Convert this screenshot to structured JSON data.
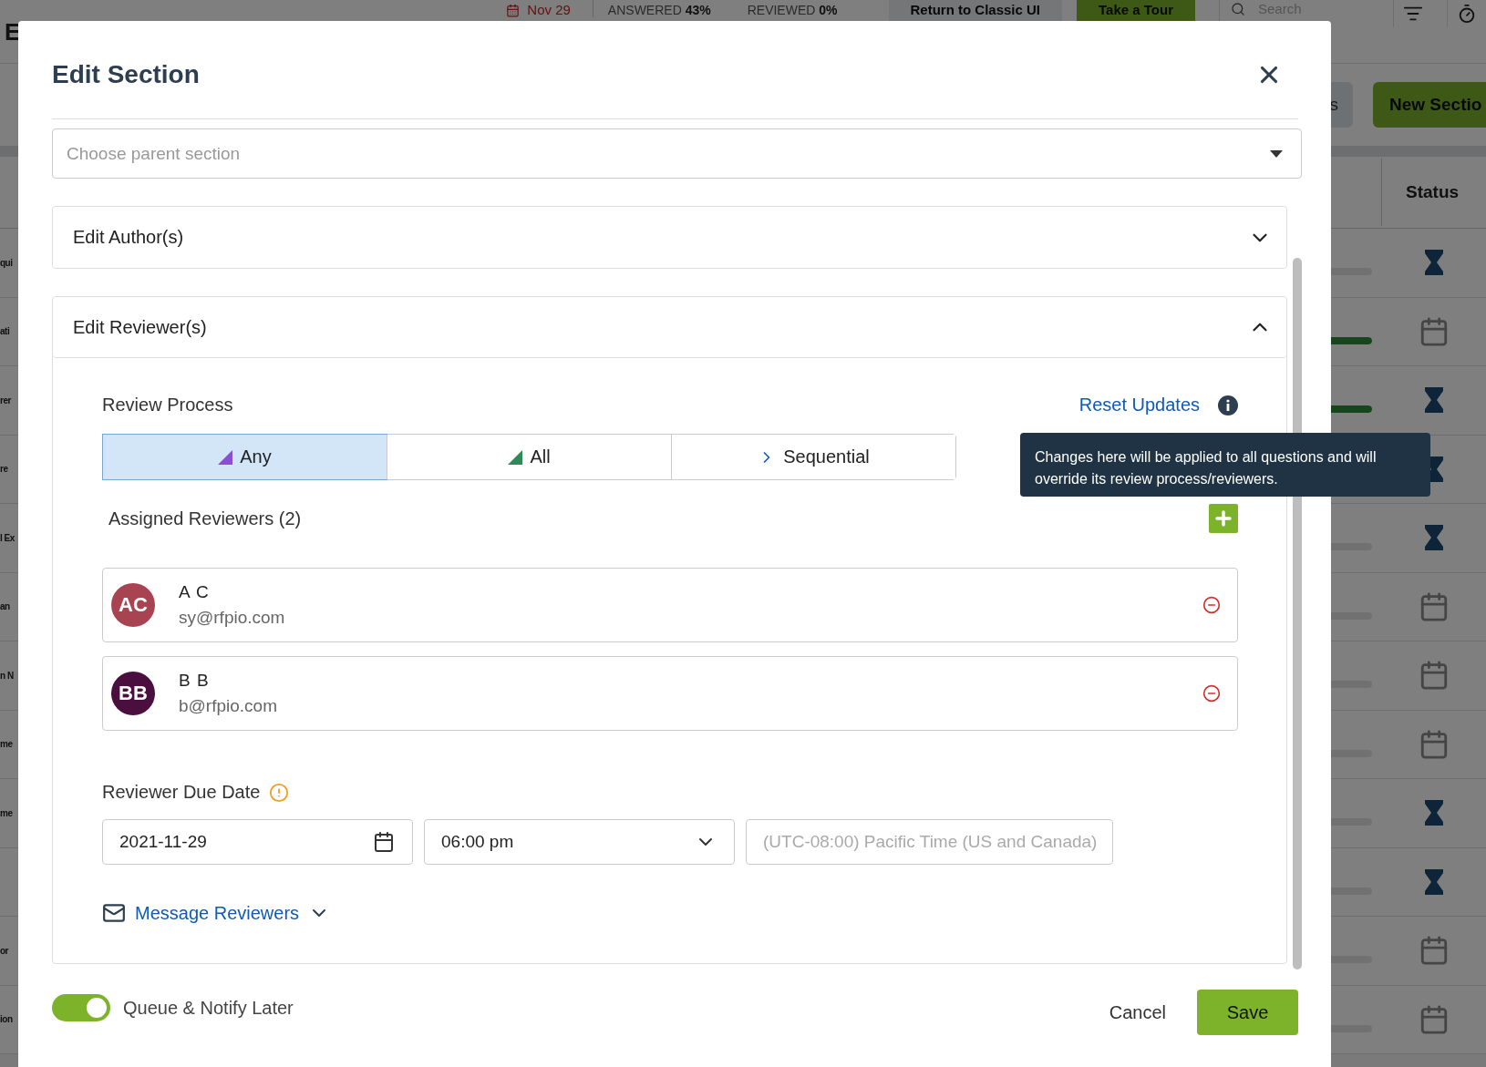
{
  "background": {
    "top_bar": {
      "brand_fragment": "E",
      "due_date": "Nov 29",
      "answered_label": "ANSWERED",
      "answered_value": "43%",
      "reviewed_label": "REVIEWED",
      "reviewed_value": "0%",
      "classic_button": "Return to Classic UI",
      "tour_button": "Take a Tour",
      "search_placeholder": "Search"
    },
    "actions": {
      "partial_button": "s",
      "new_section_button": "New Sectio"
    },
    "table": {
      "status_header": "Status",
      "rows": [
        {
          "label_fragment": "qui",
          "kind": "pending",
          "level": 0
        },
        {
          "label_fragment": "ati",
          "kind": "scheduled",
          "level": 1
        },
        {
          "label_fragment": "rer",
          "kind": "pending",
          "level": 1
        },
        {
          "label_fragment": "re",
          "kind": "pending",
          "level": 0
        },
        {
          "label_fragment": "l Ex",
          "kind": "pending",
          "level": 0
        },
        {
          "label_fragment": "an",
          "kind": "scheduled",
          "level": 0
        },
        {
          "label_fragment": "n N",
          "kind": "scheduled",
          "level": 0
        },
        {
          "label_fragment": "me",
          "kind": "scheduled",
          "level": 0
        },
        {
          "label_fragment": "me",
          "kind": "pending",
          "level": 0
        },
        {
          "kind": "pending"
        },
        {
          "label_fragment": "or",
          "kind": "scheduled",
          "level": 0
        },
        {
          "label_fragment": "ion",
          "kind": "scheduled",
          "level": 0
        }
      ]
    }
  },
  "modal": {
    "title": "Edit Section",
    "parent_select": {
      "placeholder": "Choose parent section"
    },
    "sections": [
      {
        "title": "Edit Author(s)",
        "expanded": false
      },
      {
        "title": "Edit Reviewer(s)",
        "expanded": true
      }
    ],
    "review": {
      "process_label": "Review Process",
      "reset_link": "Reset Updates",
      "tooltip": "Changes here will be applied to all questions and will override its review process/reviewers.",
      "process_options": [
        {
          "label": "Any",
          "selected": true,
          "kind": "any"
        },
        {
          "label": "All",
          "selected": false,
          "kind": "all"
        },
        {
          "label": "Sequential",
          "selected": false,
          "kind": "sequential"
        }
      ],
      "assigned_label": "Assigned Reviewers (2)",
      "reviewers": [
        {
          "initials": "AC",
          "name": "A C",
          "email": "sy@rfpio.com",
          "color": "#a84452"
        },
        {
          "initials": "BB",
          "name": "B B",
          "email": "b@rfpio.com",
          "color": "#4a0e3f"
        }
      ],
      "due_label": "Reviewer Due Date",
      "due_date": {
        "value": "2021-11-29"
      },
      "due_time": {
        "value": "06:00 pm"
      },
      "timezone": {
        "placeholder": "(UTC-08:00) Pacific Time (US and Canada)"
      },
      "message_link": "Message Reviewers"
    },
    "footer": {
      "queue_toggle": {
        "label": "Queue & Notify Later",
        "on": true
      },
      "cancel": "Cancel",
      "save": "Save"
    }
  }
}
